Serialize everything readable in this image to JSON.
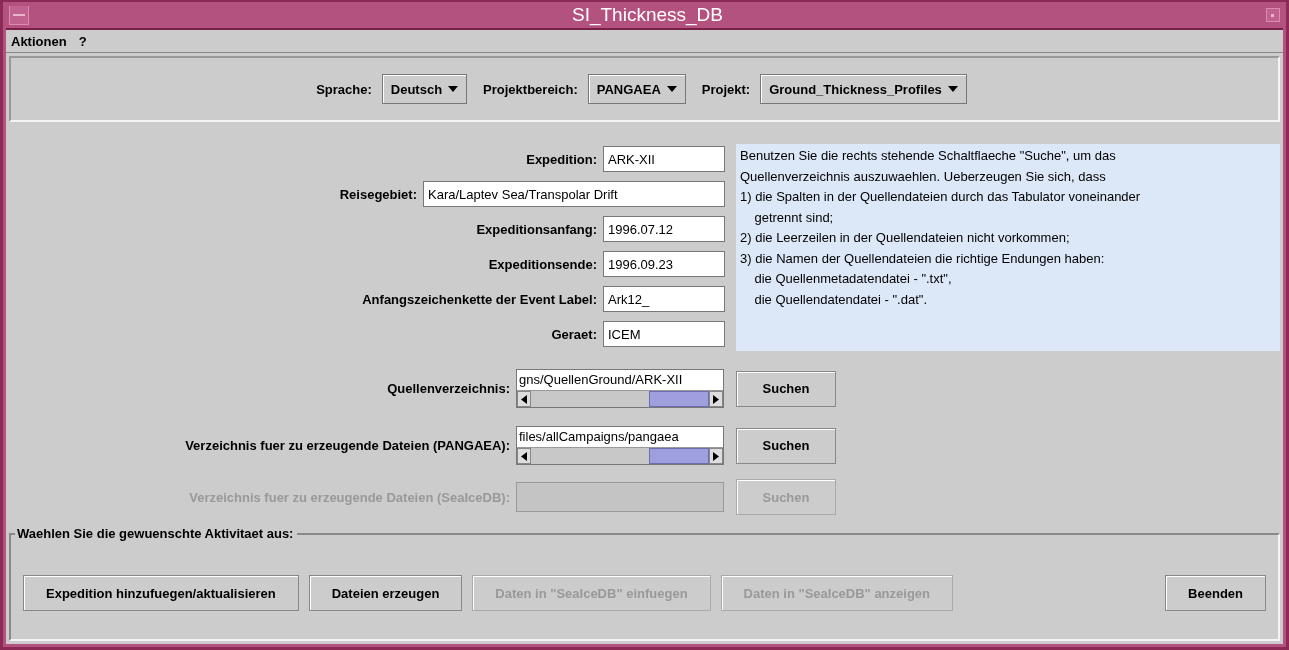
{
  "window": {
    "title": "SI_Thickness_DB"
  },
  "menu": [
    "Aktionen",
    "?"
  ],
  "selectors": [
    {
      "label": "Sprache:",
      "value": "Deutsch"
    },
    {
      "label": "Projektbereich:",
      "value": "PANGAEA"
    },
    {
      "label": "Projekt:",
      "value": "Ground_Thickness_Profiles"
    }
  ],
  "fields": [
    {
      "label": "Expedition:",
      "value": "ARK-XII",
      "kind": "short"
    },
    {
      "label": "Reisegebiet:",
      "value": "Kara/Laptev Sea/Transpolar Drift",
      "kind": "wide"
    },
    {
      "label": "Expeditionsanfang:",
      "value": "1996.07.12",
      "kind": "short"
    },
    {
      "label": "Expeditionsende:",
      "value": "1996.09.23",
      "kind": "short"
    },
    {
      "label": "Anfangszeichenkette der Event Label:",
      "value": "Ark12_",
      "kind": "short"
    },
    {
      "label": "Geraet:",
      "value": "ICEM",
      "kind": "short"
    }
  ],
  "info": [
    "Benutzen Sie die rechts stehende Schaltflaeche \"Suche\", um das",
    "Quellenverzeichnis auszuwaehlen. Ueberzeugen Sie sich, dass",
    "1) die Spalten in der Quellendateien durch das Tabulator voneinander",
    "    getrennt sind;",
    "2) die Leerzeilen in der Quellendateien nicht vorkommen;",
    "3) die Namen der Quellendateien die richtige Endungen haben:",
    "    die Quellenmetadatendatei - \".txt\",",
    "    die Quellendatendatei - \".dat\"."
  ],
  "paths": [
    {
      "label": "Quellenverzeichnis:",
      "value": "gns/QuellenGround/ARK-XII",
      "button": "Suchen",
      "disabled": false
    },
    {
      "label": "Verzeichnis fuer zu erzeugende Dateien (PANGAEA):",
      "value": "files/allCampaigns/pangaea",
      "button": "Suchen",
      "disabled": false
    },
    {
      "label": "Verzeichnis fuer zu erzeugende Dateien (SeaIceDB):",
      "button": "Suchen",
      "disabled": true
    }
  ],
  "activity": {
    "title": "Waehlen Sie die gewuenschte Aktivitaet aus:",
    "buttons": [
      {
        "label": "Expedition hinzufuegen/aktualisieren",
        "disabled": false
      },
      {
        "label": "Dateien erzeugen",
        "disabled": false
      },
      {
        "label": "Daten in \"SeaIceDB\" einfuegen",
        "disabled": true
      },
      {
        "label": "Daten in \"SeaIceDB\" anzeigen",
        "disabled": true
      },
      {
        "label": "Beenden",
        "disabled": false
      }
    ]
  }
}
